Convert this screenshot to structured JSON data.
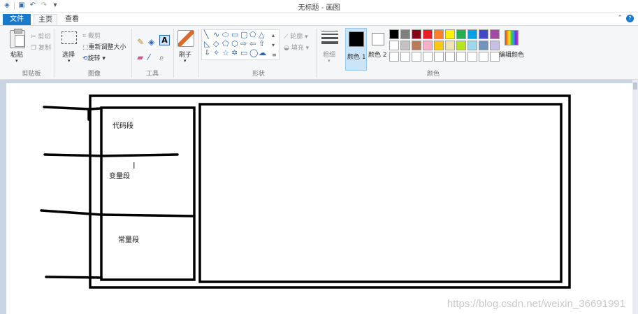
{
  "window": {
    "title": "无标题 - 画图"
  },
  "quick_access": {
    "icons": [
      "app-icon",
      "save-icon",
      "undo-icon",
      "redo-icon",
      "customize-icon"
    ]
  },
  "tabs": {
    "file": "文件",
    "home": "主页",
    "view": "查看"
  },
  "ribbon": {
    "clipboard": {
      "label": "剪贴板",
      "paste": "粘贴",
      "cut": "剪切",
      "copy": "复制"
    },
    "image": {
      "label": "图像",
      "select": "选择",
      "crop": "裁剪",
      "resize": "重新调整大小",
      "rotate": "旋转"
    },
    "tools": {
      "label": "工具"
    },
    "brushes": {
      "label": "刷子"
    },
    "shapes": {
      "label": "形状",
      "outline": "轮廓",
      "fill": "填充"
    },
    "size": {
      "label": "粗细"
    },
    "colors": {
      "label": "颜色",
      "color1": "颜色 1",
      "color2": "颜色 2",
      "edit_colors": "编辑颜色",
      "palette": [
        "#000000",
        "#7f7f7f",
        "#880015",
        "#ed1c24",
        "#ff7f27",
        "#fff200",
        "#22b14c",
        "#00a2e8",
        "#3f48cc",
        "#a349a4",
        "#ffffff",
        "#c3c3c3",
        "#b97a57",
        "#ffaec9",
        "#ffc90e",
        "#efe4b0",
        "#b5e61d",
        "#99d9ea",
        "#7092be",
        "#c8bfe7",
        "#ffffff",
        "#ffffff",
        "#ffffff",
        "#ffffff",
        "#ffffff",
        "#ffffff",
        "#ffffff",
        "#ffffff",
        "#ffffff",
        "#ffffff"
      ]
    }
  },
  "canvas": {
    "labels": {
      "code": "代码段",
      "variable": "变量段",
      "constant": "常量段"
    },
    "watermark": "https://blog.csdn.net/weixin_36691991"
  }
}
